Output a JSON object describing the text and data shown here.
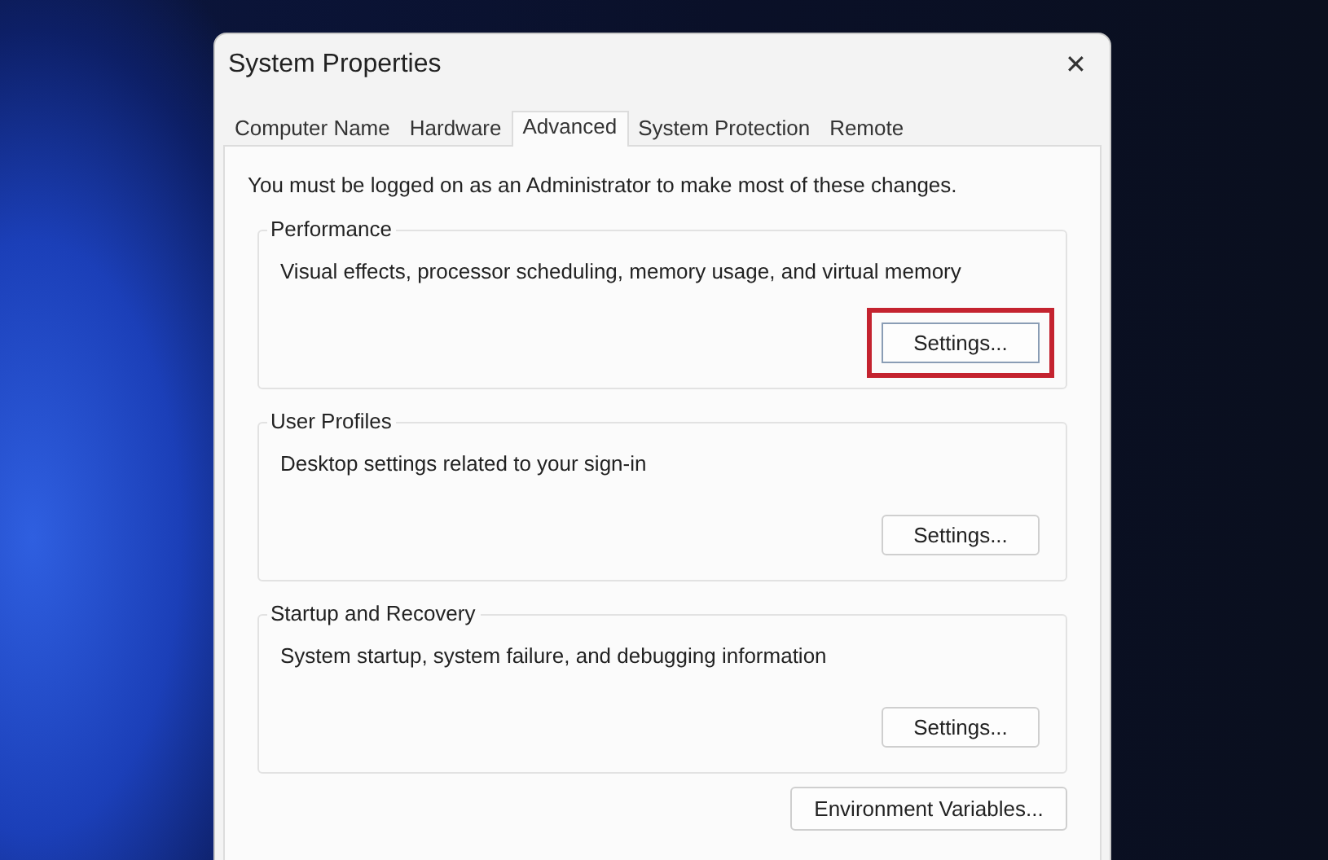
{
  "window": {
    "title": "System Properties",
    "close": "✕"
  },
  "tabs": [
    {
      "label": "Computer Name",
      "selected": false
    },
    {
      "label": "Hardware",
      "selected": false
    },
    {
      "label": "Advanced",
      "selected": true
    },
    {
      "label": "System Protection",
      "selected": false
    },
    {
      "label": "Remote",
      "selected": false
    }
  ],
  "notice": "You must be logged on as an Administrator to make most of these changes.",
  "groups": [
    {
      "title": "Performance",
      "description": "Visual effects, processor scheduling, memory usage, and virtual memory",
      "button": "Settings...",
      "highlighted": true
    },
    {
      "title": "User Profiles",
      "description": "Desktop settings related to your sign-in",
      "button": "Settings...",
      "highlighted": false
    },
    {
      "title": "Startup and Recovery",
      "description": "System startup, system failure, and debugging information",
      "button": "Settings...",
      "highlighted": false
    }
  ],
  "bottom_button": "Environment Variables..."
}
